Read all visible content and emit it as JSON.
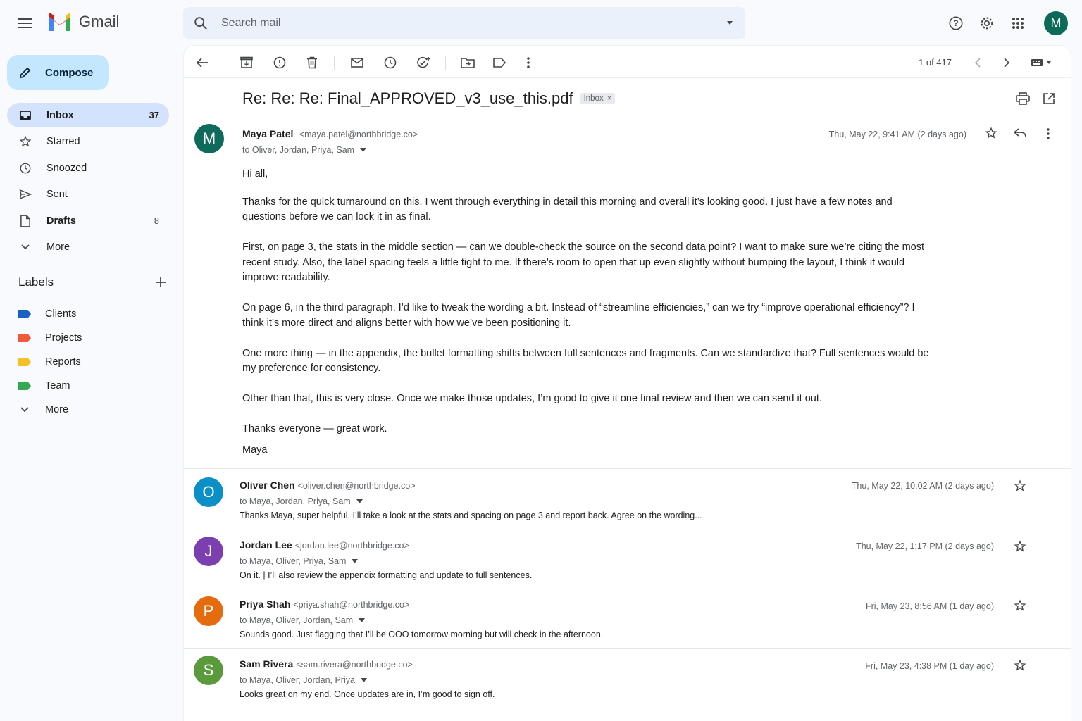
{
  "app": {
    "name": "Gmail",
    "brand_color": "#ea4335",
    "accent": "#c2e7ff"
  },
  "search": {
    "placeholder": "Search mail"
  },
  "account": {
    "avatar_letter": "M",
    "avatar_color": "#0b6b57"
  },
  "sidebar": {
    "compose_label": "Compose",
    "nav": [
      {
        "label": "Inbox",
        "count": "37",
        "icon": "inbox-icon",
        "active": true
      },
      {
        "label": "Starred",
        "count": "",
        "icon": "star-icon"
      },
      {
        "label": "Snoozed",
        "count": "",
        "icon": "clock-icon"
      },
      {
        "label": "Sent",
        "count": "",
        "icon": "send-icon"
      },
      {
        "label": "Drafts",
        "count": "8",
        "icon": "draft-icon"
      },
      {
        "label": "More",
        "count": "",
        "icon": "chevron-down-icon"
      }
    ],
    "labels_title": "Labels",
    "labels": [
      {
        "label": "Clients",
        "color": "#1a5fc4"
      },
      {
        "label": "Projects",
        "color": "#ef5a3c"
      },
      {
        "label": "Reports",
        "color": "#f6bf26"
      },
      {
        "label": "Team",
        "color": "#34a853"
      }
    ],
    "labels_more": "More"
  },
  "toolbar": {
    "page_count": "1 of 417"
  },
  "thread": {
    "subject": "Re: Re: Re: Final_APPROVED_v3_use_this.pdf",
    "chip": "Inbox",
    "expanded": {
      "avatar": "M",
      "avatar_color": "#0e6b5c",
      "sender": "Maya Patel",
      "email": "<maya.patel@northbridge.co>",
      "to": "to Oliver, Jordan, Priya, Sam",
      "date": "Thu, May 22, 9:41 AM (2 days ago)",
      "greeting": "Hi all,",
      "p1": "Thanks for the quick turnaround on this. I went through everything in detail this morning and overall it’s looking good. I just have a few notes and questions before we can lock it in as final.",
      "p2": "First, on page 3, the stats in the middle section — can we double-check the source on the second data point? I want to make sure we’re citing the most recent study. Also, the label spacing feels a little tight to me. If there’s room to open that up even slightly without bumping the layout, I think it would improve readability.",
      "p3": "On page 6, in the third paragraph, I’d like to tweak the wording a bit. Instead of “streamline efficiencies,” can we try “improve operational efficiency”? I think it’s more direct and aligns better with how we’ve been positioning it.",
      "p4": "One more thing — in the appendix, the bullet formatting shifts between full sentences and fragments. Can we standardize that? Full sentences would be my preference for consistency.",
      "p5": "Other than that, this is very close. Once we make those updates, I’m good to give it one final review and then we can send it out.",
      "closing": "Thanks everyone — great work.",
      "signature": "Maya"
    },
    "replies": [
      {
        "avatar": "O",
        "avatar_color": "#0b8fc7",
        "sender": "Oliver Chen",
        "email": "<oliver.chen@northbridge.co>",
        "to": "to Maya, Jordan, Priya, Sam",
        "date": "Thu, May 22, 10:02 AM (2 days ago)",
        "snippet": "Thanks Maya, super helpful. I’ll take a look at the stats and spacing on page 3 and report back. Agree on the wording..."
      },
      {
        "avatar": "J",
        "avatar_color": "#7b3fb0",
        "sender": "Jordan Lee",
        "email": "<jordan.lee@northbridge.co>",
        "to": "to Maya, Oliver, Priya, Sam",
        "date": "Thu, May 22, 1:17 PM (2 days ago)",
        "snippet": "On it. | I’ll also review the appendix formatting and update to full sentences."
      },
      {
        "avatar": "P",
        "avatar_color": "#e56b0f",
        "sender": "Priya Shah",
        "email": "<priya.shah@northbridge.co>",
        "to": "to Maya, Oliver, Jordan, Sam",
        "date": "Fri, May 23, 8:56 AM (1 day ago)",
        "snippet": "Sounds good. Just flagging that I’ll be OOO tomorrow morning but will check in the afternoon."
      },
      {
        "avatar": "S",
        "avatar_color": "#5a9a3c",
        "sender": "Sam Rivera",
        "email": "<sam.rivera@northbridge.co>",
        "to": "to Maya, Oliver, Jordan, Priya",
        "date": "Fri, May 23, 4:38 PM (1 day ago)",
        "snippet": "Looks great on my end. Once updates are in, I’m good to sign off."
      }
    ]
  }
}
